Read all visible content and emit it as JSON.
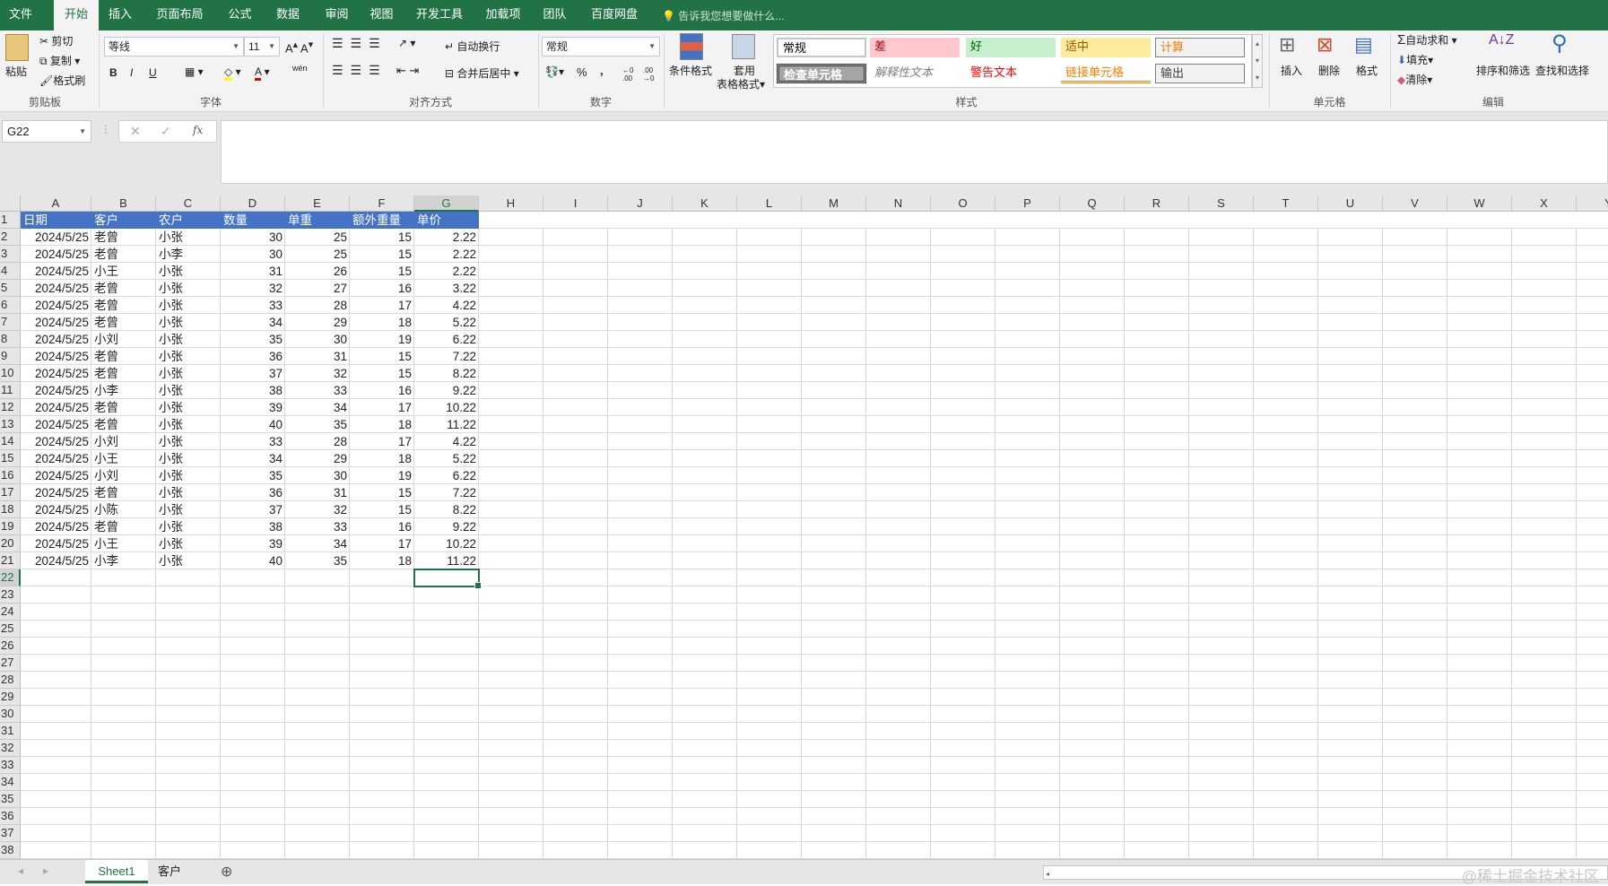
{
  "menu_tabs": [
    "文件",
    "开始",
    "插入",
    "页面布局",
    "公式",
    "数据",
    "审阅",
    "视图",
    "开发工具",
    "加载项",
    "团队",
    "百度网盘"
  ],
  "active_tab": "开始",
  "tell_me": "告诉我您想要做什么...",
  "clipboard": {
    "paste": "粘贴",
    "cut": "剪切",
    "copy": "复制",
    "format_painter": "格式刷",
    "label": "剪贴板"
  },
  "font": {
    "name": "等线",
    "size": "11",
    "bold": "B",
    "italic": "I",
    "underline": "U",
    "wen": "wén",
    "label": "字体"
  },
  "alignment": {
    "wrap": "自动换行",
    "merge": "合并后居中",
    "label": "对齐方式"
  },
  "number": {
    "format": "常规",
    "percent": "%",
    "comma": ",",
    "inc": "←0 .00",
    "dec": ".00 →0",
    "label": "数字"
  },
  "styles": {
    "conditional": "条件格式",
    "table1": "套用",
    "table2": "表格格式",
    "label": "样式",
    "gallery": [
      {
        "text": "常规",
        "bg": "#ffffff",
        "fg": "#000000"
      },
      {
        "text": "差",
        "bg": "#ffc7ce",
        "fg": "#9c0006"
      },
      {
        "text": "好",
        "bg": "#c6efce",
        "fg": "#006100"
      },
      {
        "text": "适中",
        "bg": "#ffeb9c",
        "fg": "#9c5700"
      },
      {
        "text": "计算",
        "bg": "#f2f2f2",
        "fg": "#fa7d00"
      },
      {
        "text": "检查单元格",
        "bg": "#a5a5a5",
        "fg": "#ffffff"
      },
      {
        "text": "解释性文本",
        "bg": "#ffffff",
        "fg": "#7f7f7f"
      },
      {
        "text": "警告文本",
        "bg": "#ffffff",
        "fg": "#ff0000"
      },
      {
        "text": "链接单元格",
        "bg": "#ffffff",
        "fg": "#fa7d00"
      },
      {
        "text": "输出",
        "bg": "#f2f2f2",
        "fg": "#3f3f3f"
      }
    ]
  },
  "cells_group": {
    "insert": "插入",
    "delete": "删除",
    "format": "格式",
    "label": "单元格"
  },
  "editing": {
    "autosum": "自动求和",
    "fill": "填充",
    "clear": "清除",
    "sort": "排序和筛选",
    "find": "查找和选择",
    "label": "编辑"
  },
  "name_box": "G22",
  "fx": "fx",
  "columns": [
    "A",
    "B",
    "C",
    "D",
    "E",
    "F",
    "G",
    "H",
    "I",
    "J",
    "K",
    "L",
    "M",
    "N",
    "O",
    "P",
    "Q",
    "R",
    "S",
    "T",
    "U",
    "V",
    "W",
    "X",
    "Y"
  ],
  "selected_column": "G",
  "selected_row": 22,
  "row_count": 38,
  "table": {
    "headers": [
      "日期",
      "客户",
      "农户",
      "数量",
      "单重",
      "额外重量",
      "单价"
    ],
    "rows": [
      [
        "2024/5/25",
        "老曾",
        "小张",
        30,
        25,
        15,
        "2.22"
      ],
      [
        "2024/5/25",
        "老曾",
        "小李",
        30,
        25,
        15,
        "2.22"
      ],
      [
        "2024/5/25",
        "小王",
        "小张",
        31,
        26,
        15,
        "2.22"
      ],
      [
        "2024/5/25",
        "老曾",
        "小张",
        32,
        27,
        16,
        "3.22"
      ],
      [
        "2024/5/25",
        "老曾",
        "小张",
        33,
        28,
        17,
        "4.22"
      ],
      [
        "2024/5/25",
        "老曾",
        "小张",
        34,
        29,
        18,
        "5.22"
      ],
      [
        "2024/5/25",
        "小刘",
        "小张",
        35,
        30,
        19,
        "6.22"
      ],
      [
        "2024/5/25",
        "老曾",
        "小张",
        36,
        31,
        15,
        "7.22"
      ],
      [
        "2024/5/25",
        "老曾",
        "小张",
        37,
        32,
        15,
        "8.22"
      ],
      [
        "2024/5/25",
        "小李",
        "小张",
        38,
        33,
        16,
        "9.22"
      ],
      [
        "2024/5/25",
        "老曾",
        "小张",
        39,
        34,
        17,
        "10.22"
      ],
      [
        "2024/5/25",
        "老曾",
        "小张",
        40,
        35,
        18,
        "11.22"
      ],
      [
        "2024/5/25",
        "小刘",
        "小张",
        33,
        28,
        17,
        "4.22"
      ],
      [
        "2024/5/25",
        "小王",
        "小张",
        34,
        29,
        18,
        "5.22"
      ],
      [
        "2024/5/25",
        "小刘",
        "小张",
        35,
        30,
        19,
        "6.22"
      ],
      [
        "2024/5/25",
        "老曾",
        "小张",
        36,
        31,
        15,
        "7.22"
      ],
      [
        "2024/5/25",
        "小陈",
        "小张",
        37,
        32,
        15,
        "8.22"
      ],
      [
        "2024/5/25",
        "老曾",
        "小张",
        38,
        33,
        16,
        "9.22"
      ],
      [
        "2024/5/25",
        "小王",
        "小张",
        39,
        34,
        17,
        "10.22"
      ],
      [
        "2024/5/25",
        "小李",
        "小张",
        40,
        35,
        18,
        "11.22"
      ]
    ]
  },
  "sheets": [
    "Sheet1",
    "客户"
  ],
  "active_sheet": "Sheet1",
  "add_sheet": "⊕",
  "watermark": "@稀土掘金技术社区"
}
